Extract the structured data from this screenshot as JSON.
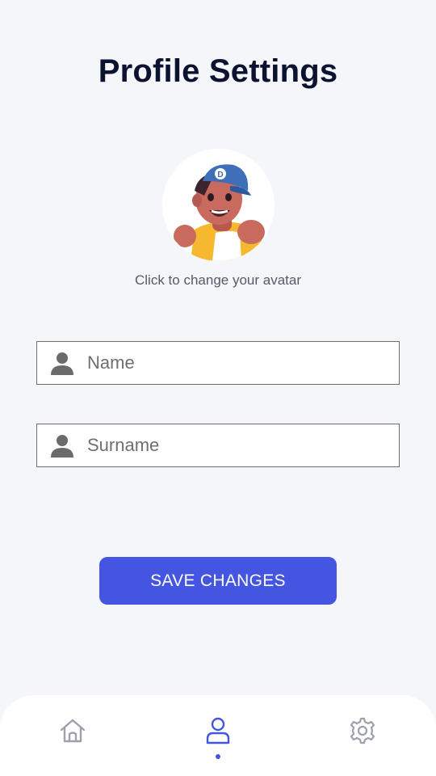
{
  "header": {
    "title": "Profile Settings"
  },
  "avatar": {
    "hint": "Click to change your avatar",
    "icon": "cartoon-avatar"
  },
  "form": {
    "name_placeholder": "Name",
    "surname_placeholder": "Surname",
    "field_icon": "person-icon"
  },
  "actions": {
    "save_label": "SAVE CHANGES"
  },
  "bottom_nav": {
    "items": [
      {
        "icon": "home-icon",
        "active": false
      },
      {
        "icon": "profile-icon",
        "active": true
      },
      {
        "icon": "settings-icon",
        "active": false
      }
    ]
  },
  "colors": {
    "background": "#f5f6fa",
    "title": "#0b1330",
    "accent": "#4355e1",
    "inactive_icon": "#9ea0aa",
    "field_border": "#6e6e6e"
  }
}
